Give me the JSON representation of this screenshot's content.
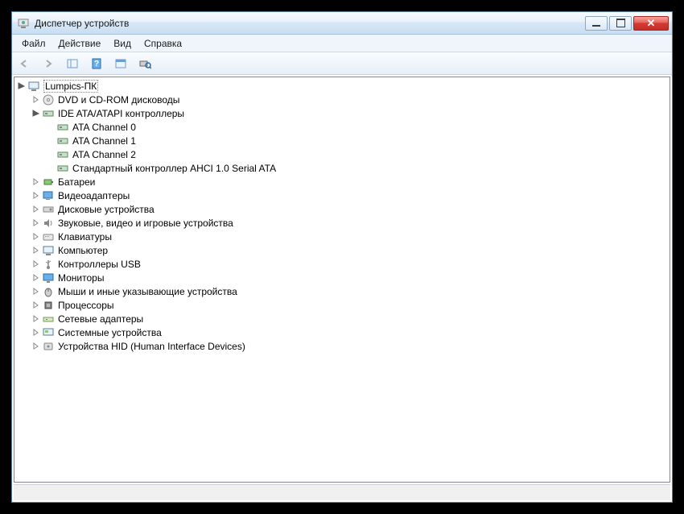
{
  "window": {
    "title": "Диспетчер устройств"
  },
  "menu": {
    "file": "Файл",
    "action": "Действие",
    "view": "Вид",
    "help": "Справка"
  },
  "tree": {
    "root": "Lumpics-ПК",
    "dvd": "DVD и CD-ROM дисководы",
    "ide": "IDE ATA/ATAPI контроллеры",
    "ide_children": {
      "ch0": "ATA Channel 0",
      "ch1": "ATA Channel 1",
      "ch2": "ATA Channel 2",
      "ahci": "Стандартный контроллер AHCI 1.0 Serial ATA"
    },
    "batteries": "Батареи",
    "display": "Видеоадаптеры",
    "disk": "Дисковые устройства",
    "sound": "Звуковые, видео и игровые устройства",
    "keyboard": "Клавиатуры",
    "computer": "Компьютер",
    "usb": "Контроллеры USB",
    "monitor": "Мониторы",
    "mouse": "Мыши и иные указывающие устройства",
    "cpu": "Процессоры",
    "network": "Сетевые адаптеры",
    "system": "Системные устройства",
    "hid": "Устройства HID (Human Interface Devices)"
  }
}
